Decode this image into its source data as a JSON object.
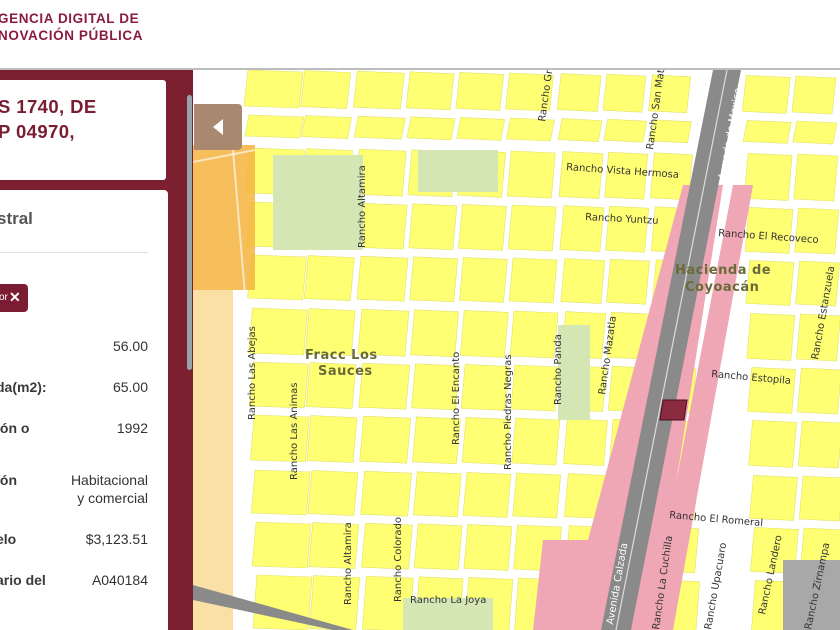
{
  "header": {
    "brand_line1": "GENCIA DIGITAL DE",
    "brand_line2": "NOVACIÓN PÚBLICA",
    "brand_color": "#8a1c3e"
  },
  "sidebar": {
    "address_line1": "S 1740, DE",
    "address_line2": "P 04970,",
    "section_title": "stral",
    "filter_chip": {
      "label": "or",
      "close_icon": "close-icon"
    },
    "fields": [
      {
        "label": ":",
        "value": "56.00"
      },
      {
        "label": "da(m2):",
        "value": "65.00"
      },
      {
        "label": "ión o",
        "value": "1992"
      },
      {
        "label": "ión",
        "value_line1": "Habitacional",
        "value_line2": "y comercial"
      },
      {
        "label": "elo",
        "value": "$3,123.51"
      },
      {
        "label": "ario del",
        "value": "A040184"
      }
    ],
    "accent_color": "#7a2030"
  },
  "map": {
    "collapse_icon": "chevron-left-icon",
    "neighborhoods": [
      "Fracc Los",
      "Sauces",
      "Hacienda de",
      "Coyoacán"
    ],
    "streets": {
      "vista_hermosa": "Rancho Vista Hermosa",
      "yuntzu": "Rancho Yuntzu",
      "recoveco": "Rancho El Recoveco",
      "estopila": "Rancho Estopila",
      "romeral": "Rancho El Romeral",
      "la_joya": "Rancho La Joya",
      "altamira_top": "Rancho Altamira",
      "altamira_bottom": "Rancho Altamira",
      "las_abejas": "Rancho Las Abejas",
      "las_animas": "Rancho Las Animas",
      "colorado": "Rancho Colorado",
      "el_encanto": "Rancho El Encanto",
      "piedras_negras": "Rancho Piedras Negras",
      "panda": "Rancho Panda",
      "mazatla": "Rancho Mazatla",
      "armada": "Armada de Mexico",
      "calz_mexico": "Avenida Calzada",
      "la_cuchilla": "Rancho La Cuchilla",
      "upacuaro": "Rancho Upacuaro",
      "landero": "Rancho Landero",
      "zirnampa": "Rancho Zirnampa",
      "san_mat": "Rancho San Mat",
      "estanzuela": "Rancho Estanzuela",
      "gr": "Rancho Gr"
    },
    "colors": {
      "block": "#ffff73",
      "park": "#d3e6b4",
      "commercial": "#f0a7b5",
      "orange": "#f5b440",
      "road": "#808080",
      "selected": "#8c2a40"
    }
  }
}
